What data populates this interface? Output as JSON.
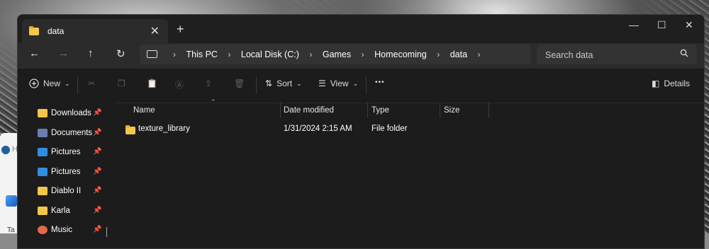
{
  "tab": {
    "title": "data",
    "close": "✕",
    "new_tab": "+"
  },
  "window_controls": {
    "minimize": "—",
    "maximize": "☐",
    "close": "✕"
  },
  "nav": {
    "back": "←",
    "forward": "→",
    "up": "↑",
    "refresh": "↻"
  },
  "breadcrumbs": [
    "This PC",
    "Local Disk (C:)",
    "Games",
    "Homecoming",
    "data"
  ],
  "search": {
    "placeholder": "Search data"
  },
  "toolbar": {
    "new_label": "New",
    "sort_label": "Sort",
    "view_label": "View",
    "more": "•••",
    "details_label": "Details"
  },
  "sidebar": {
    "items": [
      {
        "label": "Downloads",
        "icon": "folder-icon",
        "color": "#f4c64a"
      },
      {
        "label": "Documents",
        "icon": "documents-icon",
        "color": "#6a7fb0"
      },
      {
        "label": "Pictures",
        "icon": "pictures-icon",
        "color": "#2f8ee0"
      },
      {
        "label": "Pictures",
        "icon": "pictures-icon",
        "color": "#2f8ee0"
      },
      {
        "label": "Diablo II",
        "icon": "folder-icon",
        "color": "#f4c64a"
      },
      {
        "label": "Karla",
        "icon": "folder-icon",
        "color": "#f4c64a"
      },
      {
        "label": "Music",
        "icon": "music-icon",
        "color": "#e06a4a"
      }
    ],
    "pin": "📌"
  },
  "table": {
    "columns": [
      "Name",
      "Date modified",
      "Type",
      "Size"
    ],
    "rows": [
      {
        "name": "texture_library",
        "date": "1/31/2024 2:15 AM",
        "type": "File folder",
        "size": ""
      }
    ]
  },
  "colors": {
    "window_bg": "#1c1c1c",
    "bar_bg": "#2b2b2b",
    "folder": "#f4c64a"
  }
}
